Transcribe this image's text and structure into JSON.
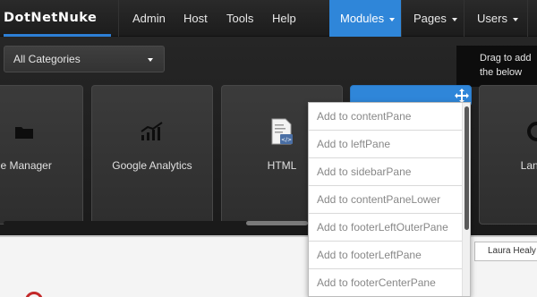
{
  "brand": {
    "logo_text": "DotNetNuke",
    "accent_color": "#2f86d9"
  },
  "nav": {
    "items": [
      {
        "label": "Admin"
      },
      {
        "label": "Host"
      },
      {
        "label": "Tools"
      },
      {
        "label": "Help"
      }
    ],
    "modules_label": "Modules",
    "pages_label": "Pages",
    "users_label": "Users"
  },
  "panel": {
    "category_select": "All Categories",
    "drag_tip": "Drag to add the below",
    "tiles": [
      {
        "label": "ile Manager",
        "icon": "folder-icon"
      },
      {
        "label": "Google Analytics",
        "icon": "analytics-icon"
      },
      {
        "label": "HTML",
        "icon": "html-document-icon"
      },
      {
        "label": "",
        "icon": "move-icon"
      },
      {
        "label": "Lang",
        "icon": "language-icon"
      }
    ]
  },
  "add_to_menu": {
    "items": [
      "Add to contentPane",
      "Add to leftPane",
      "Add to sidebarPane",
      "Add to contentPaneLower",
      "Add to footerLeftOuterPane",
      "Add to footerLeftPane",
      "Add to footerCenterPane"
    ]
  },
  "page": {
    "user_name": "Laura Healy"
  }
}
